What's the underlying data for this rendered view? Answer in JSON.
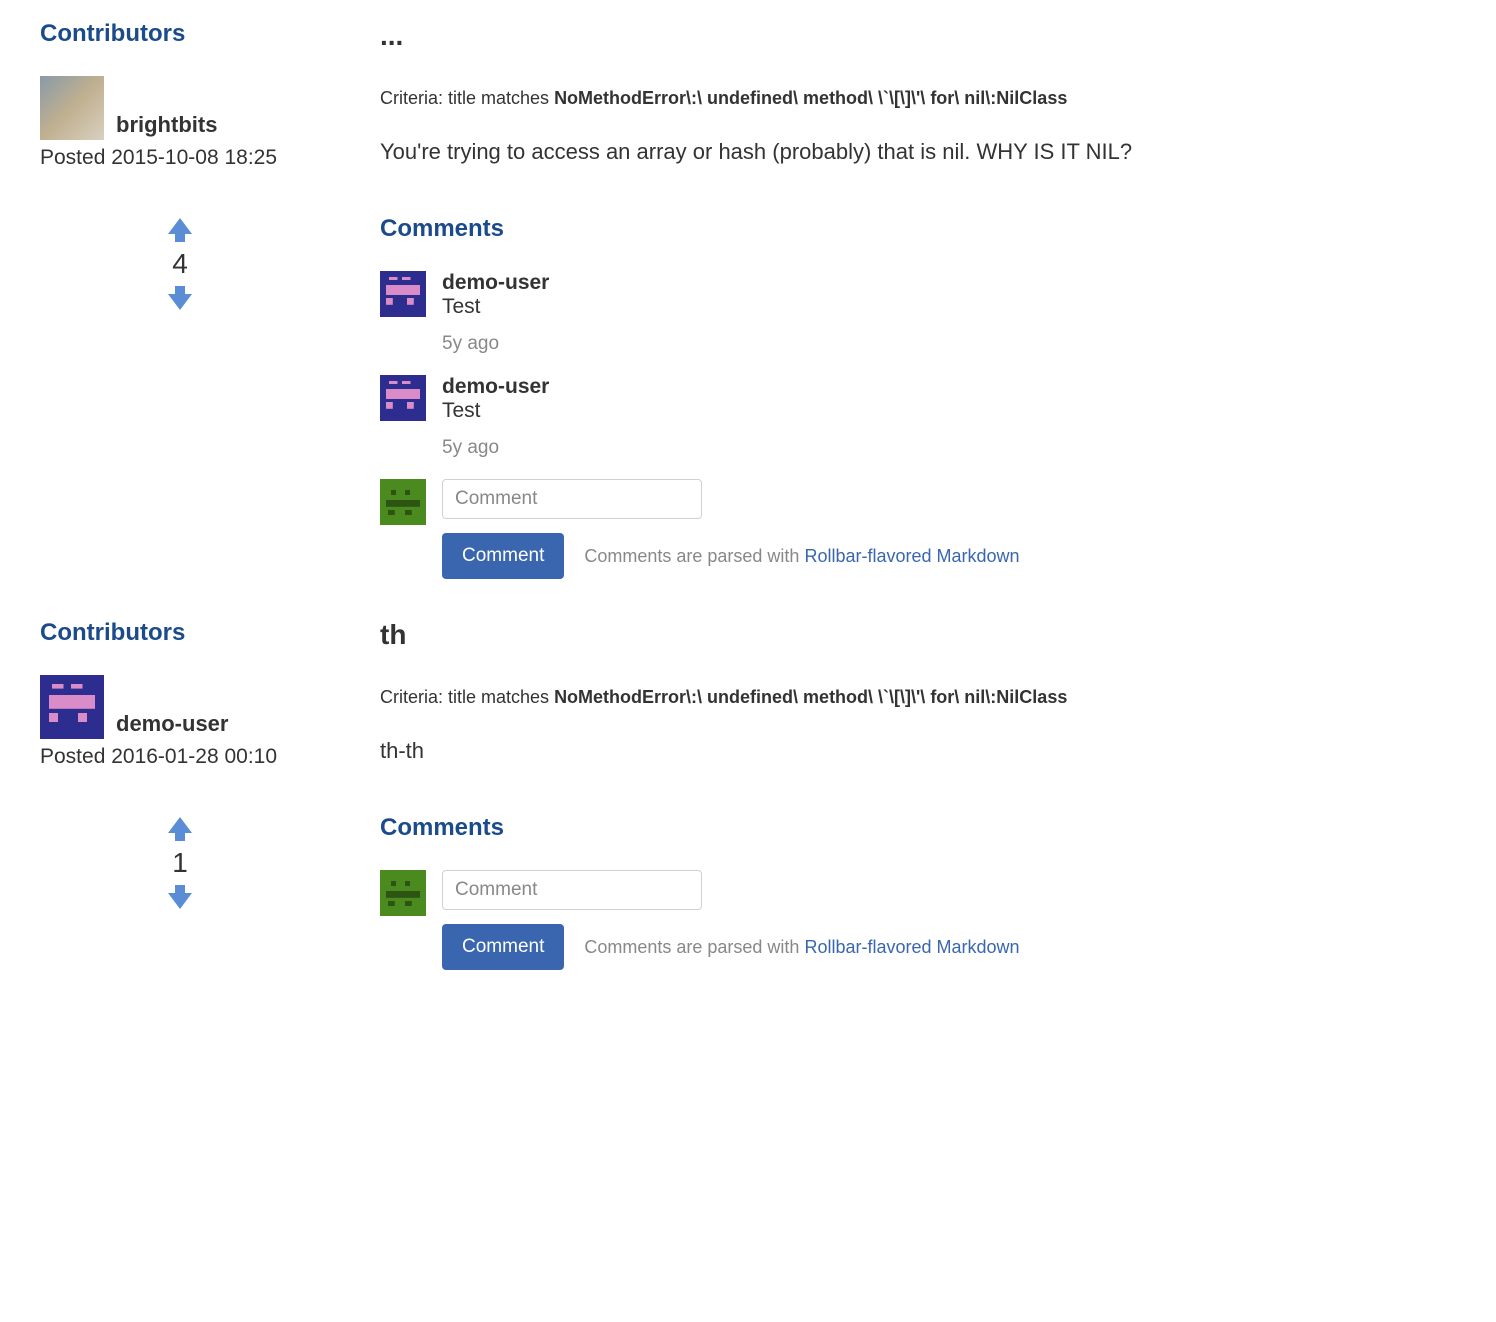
{
  "labels": {
    "contributors_heading": "Contributors",
    "posted_prefix": "Posted ",
    "comments_heading": "Comments",
    "criteria_label": "Criteria: title matches ",
    "comment_placeholder": "Comment",
    "comment_button": "Comment",
    "hint_prefix": "Comments are parsed with ",
    "hint_link": "Rollbar-flavored Markdown"
  },
  "entries": [
    {
      "contributor": {
        "username": "brightbits",
        "avatar_kind": "photo"
      },
      "posted": "2015-10-08 18:25",
      "votes": "4",
      "title": "...",
      "criteria_pattern": "NoMethodError\\:\\ undefined\\ method\\ \\`\\[\\]\\'\\ for\\ nil\\:NilClass",
      "body": "You're trying to access an array or hash (probably) that is nil. WHY IS IT NIL?",
      "comments": [
        {
          "user": "demo-user",
          "avatar_kind": "purple",
          "text": "Test",
          "time": "5y ago"
        },
        {
          "user": "demo-user",
          "avatar_kind": "purple",
          "text": "Test",
          "time": "5y ago"
        }
      ],
      "form_avatar_kind": "green"
    },
    {
      "contributor": {
        "username": "demo-user",
        "avatar_kind": "purple"
      },
      "posted": "2016-01-28 00:10",
      "votes": "1",
      "title": "th",
      "criteria_pattern": "NoMethodError\\:\\ undefined\\ method\\ \\`\\[\\]\\'\\ for\\ nil\\:NilClass",
      "body": "th-th",
      "comments": [],
      "form_avatar_kind": "green"
    }
  ]
}
